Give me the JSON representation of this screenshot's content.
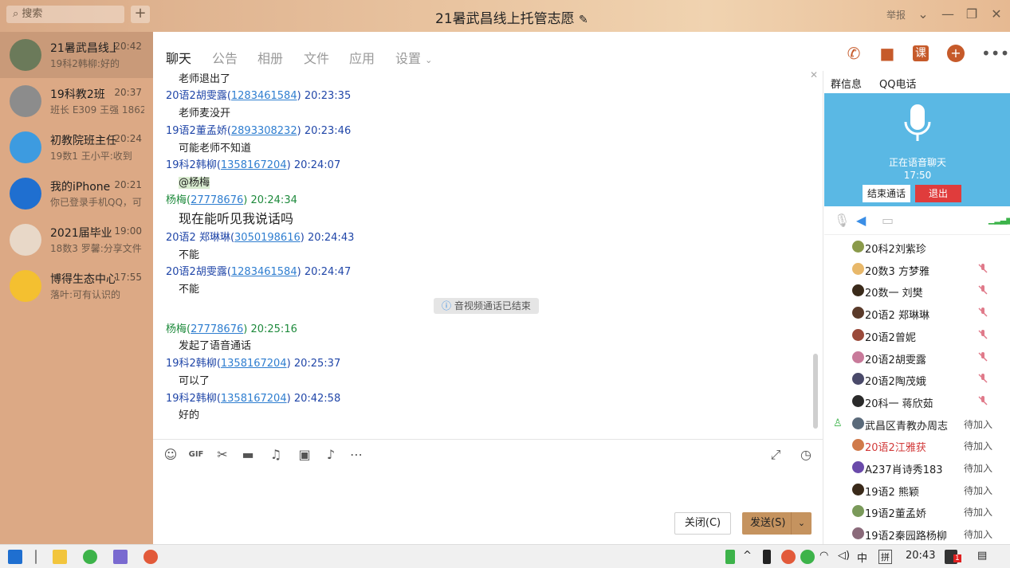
{
  "title": "21暑武昌线上托管志愿",
  "search_placeholder": "搜索",
  "report": "举报",
  "sidebar": {
    "items": [
      {
        "name": "21暑武昌线上托管志愿",
        "time": "20:42",
        "preview": "19科2韩柳:好的",
        "active": true,
        "avatar_color": "#6b7a5a"
      },
      {
        "name": "19科教2班",
        "time": "20:37",
        "preview": "班长 E309 王强 18627",
        "active": false,
        "avatar_color": "#8c8c8c"
      },
      {
        "name": "初教院班主任",
        "time": "20:24",
        "preview": "19数1 王小平:收到",
        "active": false,
        "avatar_color": "#3d9be0"
      },
      {
        "name": "我的iPhone",
        "time": "20:21",
        "preview": "你已登录手机QQ，可",
        "active": false,
        "avatar_color": "#1f6fd0"
      },
      {
        "name": "2021届毕业",
        "time": "19:00",
        "preview": "18数3 罗馨:分享文件",
        "active": false,
        "avatar_color": "#e8d8c8"
      },
      {
        "name": "博得生态中心",
        "time": "17:55",
        "preview": "落叶:可有认识的",
        "active": false,
        "avatar_color": "#f4c030"
      }
    ]
  },
  "tabs": [
    "聊天",
    "公告",
    "相册",
    "文件",
    "应用",
    "设置"
  ],
  "messages": [
    {
      "type": "text",
      "text": "老师退出了"
    },
    {
      "type": "header",
      "user": "20语2胡雯露(",
      "qq": "1283461584",
      "close": ")",
      "time": "20:23:35"
    },
    {
      "type": "text",
      "text": "老师麦没开"
    },
    {
      "type": "header",
      "user": "19语2董孟娇(",
      "qq": "2893308232",
      "close": ")",
      "time": "20:23:46"
    },
    {
      "type": "text",
      "text": "可能老师不知道"
    },
    {
      "type": "header",
      "user": "19科2韩柳(",
      "qq": "1358167204",
      "close": ")",
      "time": "20:24:07"
    },
    {
      "type": "text",
      "text": "@杨梅"
    },
    {
      "type": "header",
      "user": "杨梅(",
      "qq": "27778676",
      "close": ")",
      "time": "20:24:34"
    },
    {
      "type": "text",
      "text": "现在能听见我说话吗"
    },
    {
      "type": "header",
      "user": "20语2 郑琳琳(",
      "qq": "3050198616",
      "close": ")",
      "time": "20:24:43"
    },
    {
      "type": "text",
      "text": "不能"
    },
    {
      "type": "header",
      "user": "20语2胡雯露(",
      "qq": "1283461584",
      "close": ")",
      "time": "20:24:47"
    },
    {
      "type": "text",
      "text": "不能"
    },
    {
      "type": "header",
      "user": "杨梅(",
      "qq": "27778676",
      "close": ")",
      "time": "20:25:16"
    },
    {
      "type": "text",
      "text": "发起了语音通话"
    },
    {
      "type": "header",
      "user": "19科2韩柳(",
      "qq": "1358167204",
      "close": ")",
      "time": "20:25:37"
    },
    {
      "type": "text",
      "text": "可以了"
    },
    {
      "type": "header",
      "user": "19科2韩柳(",
      "qq": "1358167204",
      "close": ")",
      "time": "20:42:58"
    },
    {
      "type": "text",
      "text": "好的"
    }
  ],
  "system_note": "音视频通话已结束",
  "buttons": {
    "close": "关闭(C)",
    "send": "发送(S)"
  },
  "right_tabs": [
    "群信息",
    "QQ电话"
  ],
  "voice": {
    "status": "正在语音聊天",
    "time": "17:50",
    "end": "结束通话",
    "exit": "退出"
  },
  "members": [
    {
      "name": "20科2刘紫珍",
      "status": "",
      "muted": false,
      "red": false,
      "avatar_color": "#8a9a4a"
    },
    {
      "name": "20数3 方梦雅",
      "status": "",
      "muted": true,
      "red": false,
      "avatar_color": "#e8b86a"
    },
    {
      "name": "20数一 刘樊",
      "status": "",
      "muted": true,
      "red": false,
      "avatar_color": "#3a2a1a"
    },
    {
      "name": "20语2 郑琳琳",
      "status": "",
      "muted": true,
      "red": false,
      "avatar_color": "#5a3a2a"
    },
    {
      "name": "20语2曾妮",
      "status": "",
      "muted": true,
      "red": false,
      "avatar_color": "#9a4a3a"
    },
    {
      "name": "20语2胡雯露",
      "status": "",
      "muted": true,
      "red": false,
      "avatar_color": "#c87a9a"
    },
    {
      "name": "20语2陶茂娥",
      "status": "",
      "muted": true,
      "red": false,
      "avatar_color": "#4a4a6a"
    },
    {
      "name": "20科一 蒋欣茹",
      "status": "",
      "muted": true,
      "red": false,
      "avatar_color": "#2a2a2a"
    },
    {
      "name": "武昌区青教办周志",
      "status": "待加入",
      "muted": false,
      "red": false,
      "avatar_color": "#5a6a7a"
    },
    {
      "name": "20语2江雅获",
      "status": "待加入",
      "muted": false,
      "red": true,
      "avatar_color": "#d07a4a"
    },
    {
      "name": "A237肖诗秀183",
      "status": "待加入",
      "muted": false,
      "red": false,
      "avatar_color": "#6a4aaa"
    },
    {
      "name": "19语2 熊颖",
      "status": "待加入",
      "muted": false,
      "red": false,
      "avatar_color": "#3a2a1a"
    },
    {
      "name": "19语2董孟娇",
      "status": "待加入",
      "muted": false,
      "red": false,
      "avatar_color": "#7a9a5a"
    },
    {
      "name": "19语2秦园路杨柳",
      "status": "待加入",
      "muted": false,
      "red": false,
      "avatar_color": "#8a6a7a"
    }
  ],
  "taskbar": {
    "ime_zh": "中",
    "ime_pin": "拼",
    "time": "20:43",
    "notif_count": "1"
  },
  "colors": {
    "accent": "#c5935f",
    "sidebar": "#dca985",
    "voice_bg": "#5ab8e4",
    "link": "#2f7ed0"
  }
}
